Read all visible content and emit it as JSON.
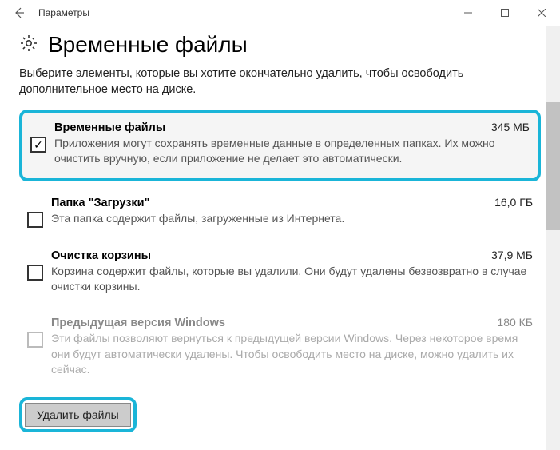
{
  "window": {
    "title": "Параметры"
  },
  "page": {
    "heading": "Временные файлы",
    "subheading": "Выберите элементы, которые вы хотите окончательно удалить, чтобы освободить дополнительное место на диске."
  },
  "items": [
    {
      "title": "Временные файлы",
      "size": "345 МБ",
      "desc": "Приложения могут сохранять временные данные в определенных папках. Их можно очистить вручную, если приложение не делает это автоматически.",
      "checked": true,
      "highlighted": true,
      "disabled": false
    },
    {
      "title": "Папка \"Загрузки\"",
      "size": "16,0 ГБ",
      "desc": "Эта папка содержит файлы, загруженные из Интернета.",
      "checked": false,
      "highlighted": false,
      "disabled": false
    },
    {
      "title": "Очистка корзины",
      "size": "37,9 МБ",
      "desc": "Корзина содержит файлы, которые вы удалили. Они будут удалены безвозвратно в случае очистки корзины.",
      "checked": false,
      "highlighted": false,
      "disabled": false
    },
    {
      "title": "Предыдущая версия Windows",
      "size": "180 КБ",
      "desc": "Эти файлы позволяют вернуться к предыдущей версии Windows. Через некоторое время они будут автоматически удалены. Чтобы освободить место на диске, можно удалить их сейчас.",
      "checked": false,
      "highlighted": false,
      "disabled": true
    }
  ],
  "actions": {
    "delete_label": "Удалить файлы"
  },
  "icons": {
    "back": "back-arrow-icon",
    "gear": "gear-icon",
    "minimize": "minimize-icon",
    "maximize": "maximize-icon",
    "close": "close-icon"
  }
}
